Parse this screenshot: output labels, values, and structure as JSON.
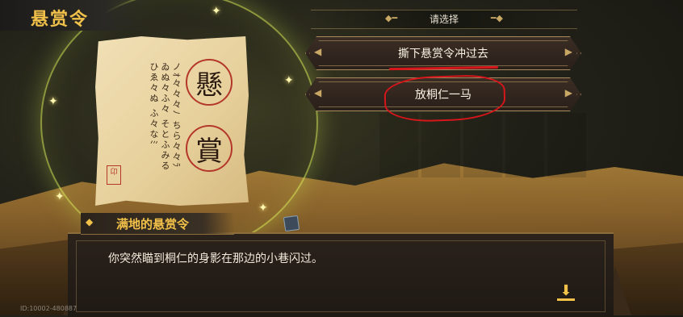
{
  "header": {
    "title": "悬赏令"
  },
  "choice": {
    "prompt": "请选择",
    "options": [
      {
        "label": "撕下悬赏令冲过去"
      },
      {
        "label": "放桐仁一马"
      }
    ]
  },
  "poster": {
    "seal_top": "懸",
    "seal_bottom": "賞",
    "stamp": "卬"
  },
  "dialog": {
    "speaker": "满地的悬赏令",
    "text": "你突然瞄到桐仁的身影在那边的小巷闪过。"
  },
  "footer": {
    "id_text": "ID:10002-480887"
  },
  "colors": {
    "accent": "#f2c14a",
    "highlight_mark": "#d6161a"
  }
}
